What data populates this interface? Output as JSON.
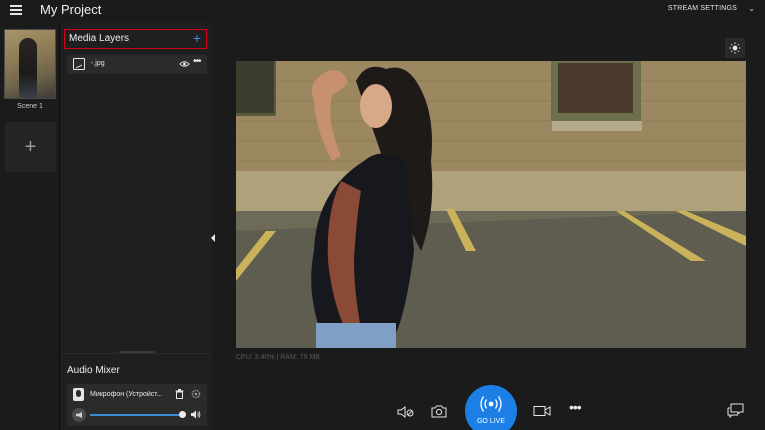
{
  "app": {
    "title": "My Project",
    "stream_settings_label": "STREAM SETTINGS"
  },
  "scenes": {
    "items": [
      {
        "label": "Scene 1"
      }
    ],
    "add_label": "+"
  },
  "layers": {
    "title": "Media Layers",
    "add_label": "+",
    "items": [
      {
        "name": "-.jpg"
      }
    ]
  },
  "audio_mixer": {
    "title": "Audio Mixer",
    "items": [
      {
        "name": "Микрофон (Устройст...",
        "volume_fraction": 0.95
      }
    ]
  },
  "preview": {
    "stats": "CPU: 3.40% | RAM: 79 MB"
  },
  "controls": {
    "go_live_label": "GO LIVE",
    "more_label": "•••"
  },
  "colors": {
    "accent": "#1b7fe6",
    "annotation": "#d0021b",
    "background": "#1b1b1b"
  }
}
